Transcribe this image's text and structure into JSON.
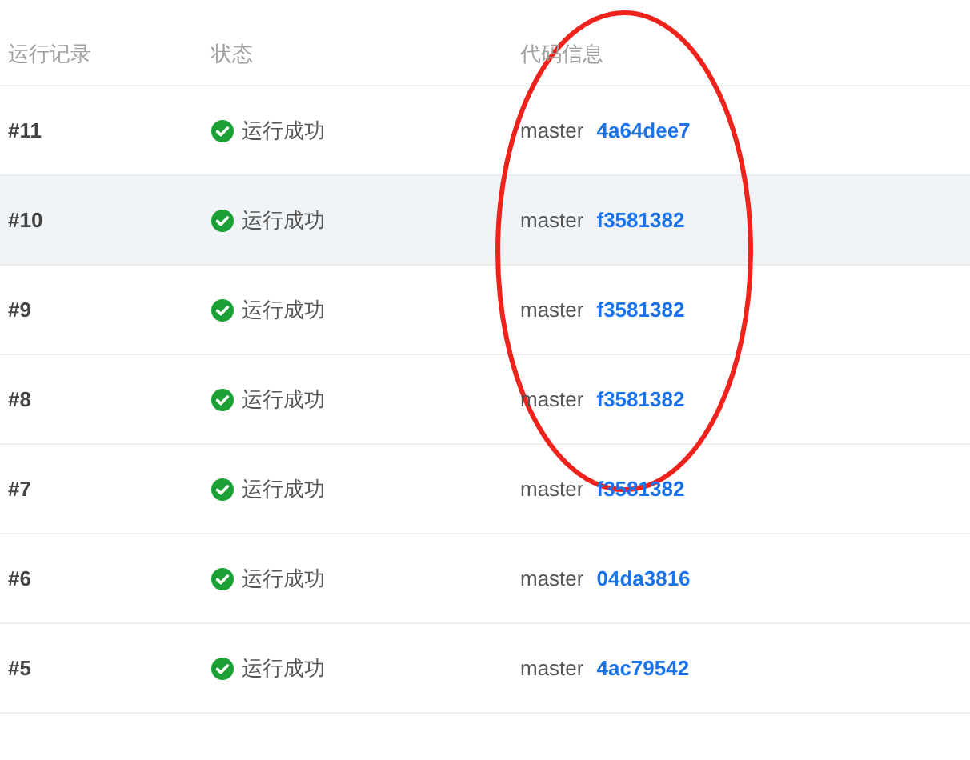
{
  "table": {
    "columns": [
      "运行记录",
      "状态",
      "代码信息"
    ],
    "rows": [
      {
        "run": "#11",
        "status": "运行成功",
        "branch": "master",
        "commit": "4a64dee7",
        "highlighted": false
      },
      {
        "run": "#10",
        "status": "运行成功",
        "branch": "master",
        "commit": "f3581382",
        "highlighted": true
      },
      {
        "run": "#9",
        "status": "运行成功",
        "branch": "master",
        "commit": "f3581382",
        "highlighted": false
      },
      {
        "run": "#8",
        "status": "运行成功",
        "branch": "master",
        "commit": "f3581382",
        "highlighted": false
      },
      {
        "run": "#7",
        "status": "运行成功",
        "branch": "master",
        "commit": "f3581382",
        "highlighted": false
      },
      {
        "run": "#6",
        "status": "运行成功",
        "branch": "master",
        "commit": "04da3816",
        "highlighted": false
      },
      {
        "run": "#5",
        "status": "运行成功",
        "branch": "master",
        "commit": "4ac79542",
        "highlighted": false
      }
    ]
  }
}
